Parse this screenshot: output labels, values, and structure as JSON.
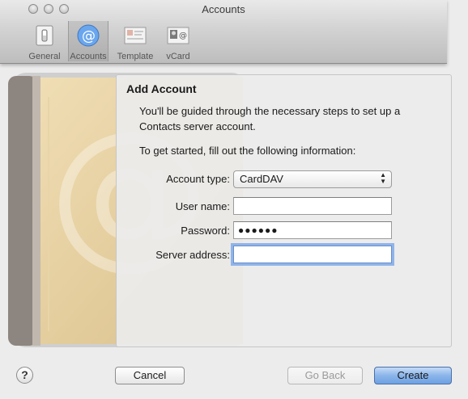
{
  "window": {
    "title": "Accounts"
  },
  "toolbar": {
    "items": [
      {
        "label": "General"
      },
      {
        "label": "Accounts",
        "selected": true
      },
      {
        "label": "Template"
      },
      {
        "label": "vCard"
      }
    ]
  },
  "sheet": {
    "title": "Add Account",
    "intro": "You'll be guided through the necessary steps to set up a Contacts server account.",
    "instruction": "To get started, fill out the following information:",
    "fields": {
      "account_type_label": "Account type:",
      "account_type_value": "CardDAV",
      "user_name_label": "User name:",
      "user_name_value": "",
      "password_label": "Password:",
      "password_value": "●●●●●●",
      "server_address_label": "Server address:",
      "server_address_value": ""
    }
  },
  "buttons": {
    "help": "?",
    "cancel": "Cancel",
    "go_back": "Go Back",
    "create": "Create"
  },
  "colors": {
    "accent": "#6ea1e2",
    "focus_ring": "#8fb4ea"
  }
}
